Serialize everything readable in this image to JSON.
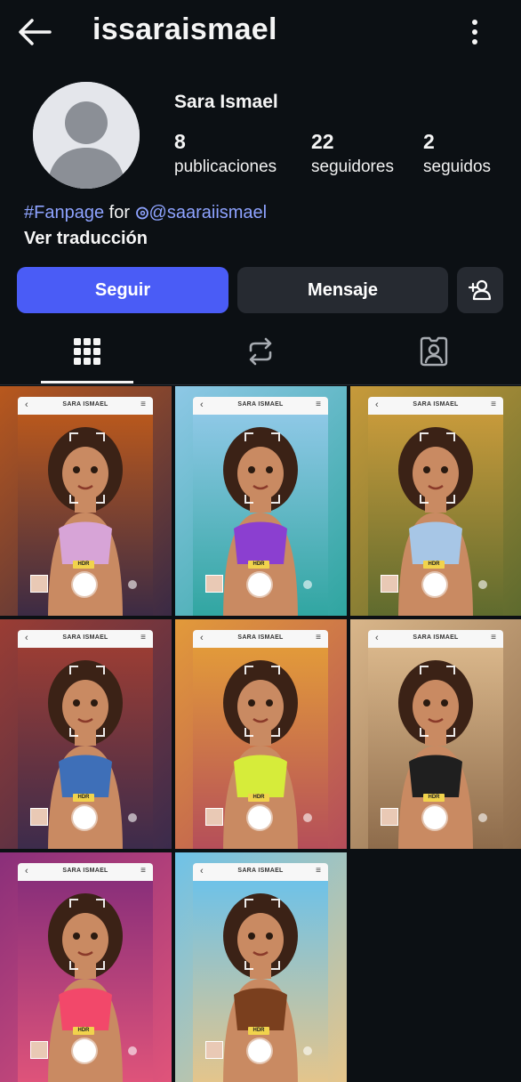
{
  "header": {
    "username": "issaraismael"
  },
  "profile": {
    "display_name": "Sara Ismael",
    "stats": [
      {
        "value": "8",
        "label": "publicaciones"
      },
      {
        "value": "22",
        "label": "seguidores"
      },
      {
        "value": "2",
        "label": "seguidos"
      }
    ],
    "bio": {
      "hashtag": "#Fanpage",
      "for_text": "for",
      "mention": "@saaraiismael"
    },
    "translate_label": "Ver traducción"
  },
  "actions": {
    "follow_label": "Seguir",
    "message_label": "Mensaje"
  },
  "tabs": [
    {
      "name": "posts-grid",
      "icon": "grid-icon",
      "active": true
    },
    {
      "name": "reposts",
      "icon": "repost-icon",
      "active": false
    },
    {
      "name": "tagged",
      "icon": "tagged-icon",
      "active": false
    }
  ],
  "posts": [
    {
      "screen_title": "SARA ISMAEL",
      "hdr_badge": "HDR",
      "bg": [
        "#b8581d",
        "#3a2a45"
      ],
      "accent": "#d7a4d7"
    },
    {
      "screen_title": "SARA ISMAEL",
      "hdr_badge": "HDR",
      "bg": [
        "#8ec8e6",
        "#2fa5a0"
      ],
      "accent": "#8b3fd0"
    },
    {
      "screen_title": "SARA ISMAEL",
      "hdr_badge": "HDR",
      "bg": [
        "#c79a3b",
        "#5d6a2e"
      ],
      "accent": "#a7c6e6"
    },
    {
      "screen_title": "SARA ISMAEL",
      "hdr_badge": "HDR",
      "bg": [
        "#9a3d34",
        "#3b2b4c"
      ],
      "accent": "#3e6fb8"
    },
    {
      "screen_title": "SARA ISMAEL",
      "hdr_badge": "HDR",
      "bg": [
        "#e29a3a",
        "#b44d5a"
      ],
      "accent": "#d6ec3a"
    },
    {
      "screen_title": "SARA ISMAEL",
      "hdr_badge": "HDR",
      "bg": [
        "#d9b68a",
        "#8c6a4a"
      ],
      "accent": "#1f1f1f"
    },
    {
      "screen_title": "SARA ISMAEL",
      "hdr_badge": "HDR",
      "bg": [
        "#8a2f7a",
        "#e0547a"
      ],
      "accent": "#f2486a"
    },
    {
      "screen_title": "SARA ISMAEL",
      "hdr_badge": "HDR",
      "bg": [
        "#6ec2e8",
        "#e6c58a"
      ],
      "accent": "#7a3f1e"
    }
  ],
  "colors": {
    "follow_button": "#4a5cf6",
    "secondary_button": "#262a31",
    "link": "#8ea3ff",
    "background": "#0c1014"
  }
}
